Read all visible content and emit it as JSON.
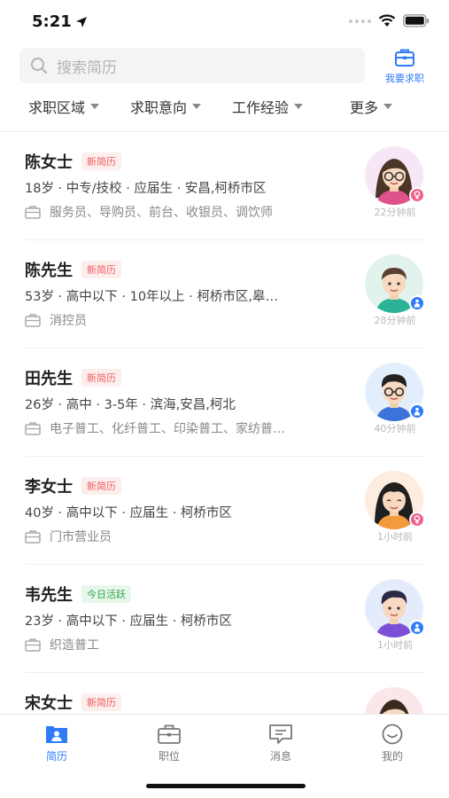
{
  "status_bar": {
    "time": "5:21"
  },
  "search": {
    "placeholder": "搜索简历"
  },
  "job_seek": {
    "label": "我要求职"
  },
  "filters": [
    {
      "label": "求职区域"
    },
    {
      "label": "求职意向"
    },
    {
      "label": "工作经验"
    },
    {
      "label": "更多"
    }
  ],
  "colors": {
    "accent": "#2f7cf6",
    "new_badge": "#f15c5c",
    "active_badge": "#2ea84b",
    "female": "#f0628a",
    "male": "#2f7cf6"
  },
  "resumes": [
    {
      "name": "陈女士",
      "badge": "新简历",
      "badge_type": "new",
      "gender": "female",
      "info": "18岁 · 中专/技校 · 应届生 · 安昌,柯桥市区",
      "jobs": "服务员、导购员、前台、收银员、调饮师",
      "time": "22分钟前"
    },
    {
      "name": "陈先生",
      "badge": "新简历",
      "badge_type": "new",
      "gender": "male",
      "info": "53岁 · 高中以下 · 10年以上 · 柯桥市区,皋…",
      "jobs": "消控员",
      "time": "28分钟前"
    },
    {
      "name": "田先生",
      "badge": "新简历",
      "badge_type": "new",
      "gender": "male",
      "info": "26岁 · 高中 · 3-5年 · 滨海,安昌,柯北",
      "jobs": "电子普工、化纤普工、印染普工、家纺普…",
      "time": "40分钟前"
    },
    {
      "name": "李女士",
      "badge": "新简历",
      "badge_type": "new",
      "gender": "female",
      "info": "40岁 · 高中以下 · 应届生 · 柯桥市区",
      "jobs": "门市营业员",
      "time": "1小时前"
    },
    {
      "name": "韦先生",
      "badge": "今日活跃",
      "badge_type": "active",
      "gender": "male",
      "info": "23岁 · 高中以下 · 应届生 · 柯桥市区",
      "jobs": "织造普工",
      "time": "1小时前"
    },
    {
      "name": "宋女士",
      "badge": "新简历",
      "badge_type": "new",
      "gender": "female",
      "info": "",
      "jobs": "",
      "time": ""
    }
  ],
  "tabs": [
    {
      "label": "简历",
      "icon": "resume-icon",
      "active": true
    },
    {
      "label": "职位",
      "icon": "briefcase-icon",
      "active": false
    },
    {
      "label": "消息",
      "icon": "message-icon",
      "active": false
    },
    {
      "label": "我的",
      "icon": "profile-icon",
      "active": false
    }
  ]
}
